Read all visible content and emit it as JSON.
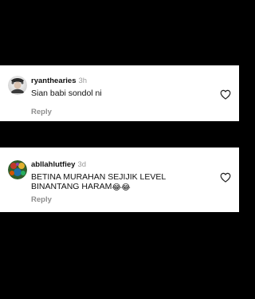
{
  "comments": [
    {
      "username": "ryanthearies",
      "time": "3h",
      "text": "Sian babi sondol ni",
      "reply_label": "Reply",
      "avatar_icon": "profile-photo-icon",
      "like_icon": "heart-outline-icon"
    },
    {
      "username": "abllahlutfiey",
      "time": "3d",
      "text": "BETINA MURAHAN SEJIJIK LEVEL BINANTANG HARAM",
      "emojis": [
        "😂",
        "😂"
      ],
      "reply_label": "Reply",
      "avatar_icon": "profile-photo-icon",
      "like_icon": "heart-outline-icon"
    }
  ],
  "colors": {
    "background": "#000000",
    "card": "#ffffff",
    "username": "#111111",
    "muted": "#8e8e8e"
  }
}
